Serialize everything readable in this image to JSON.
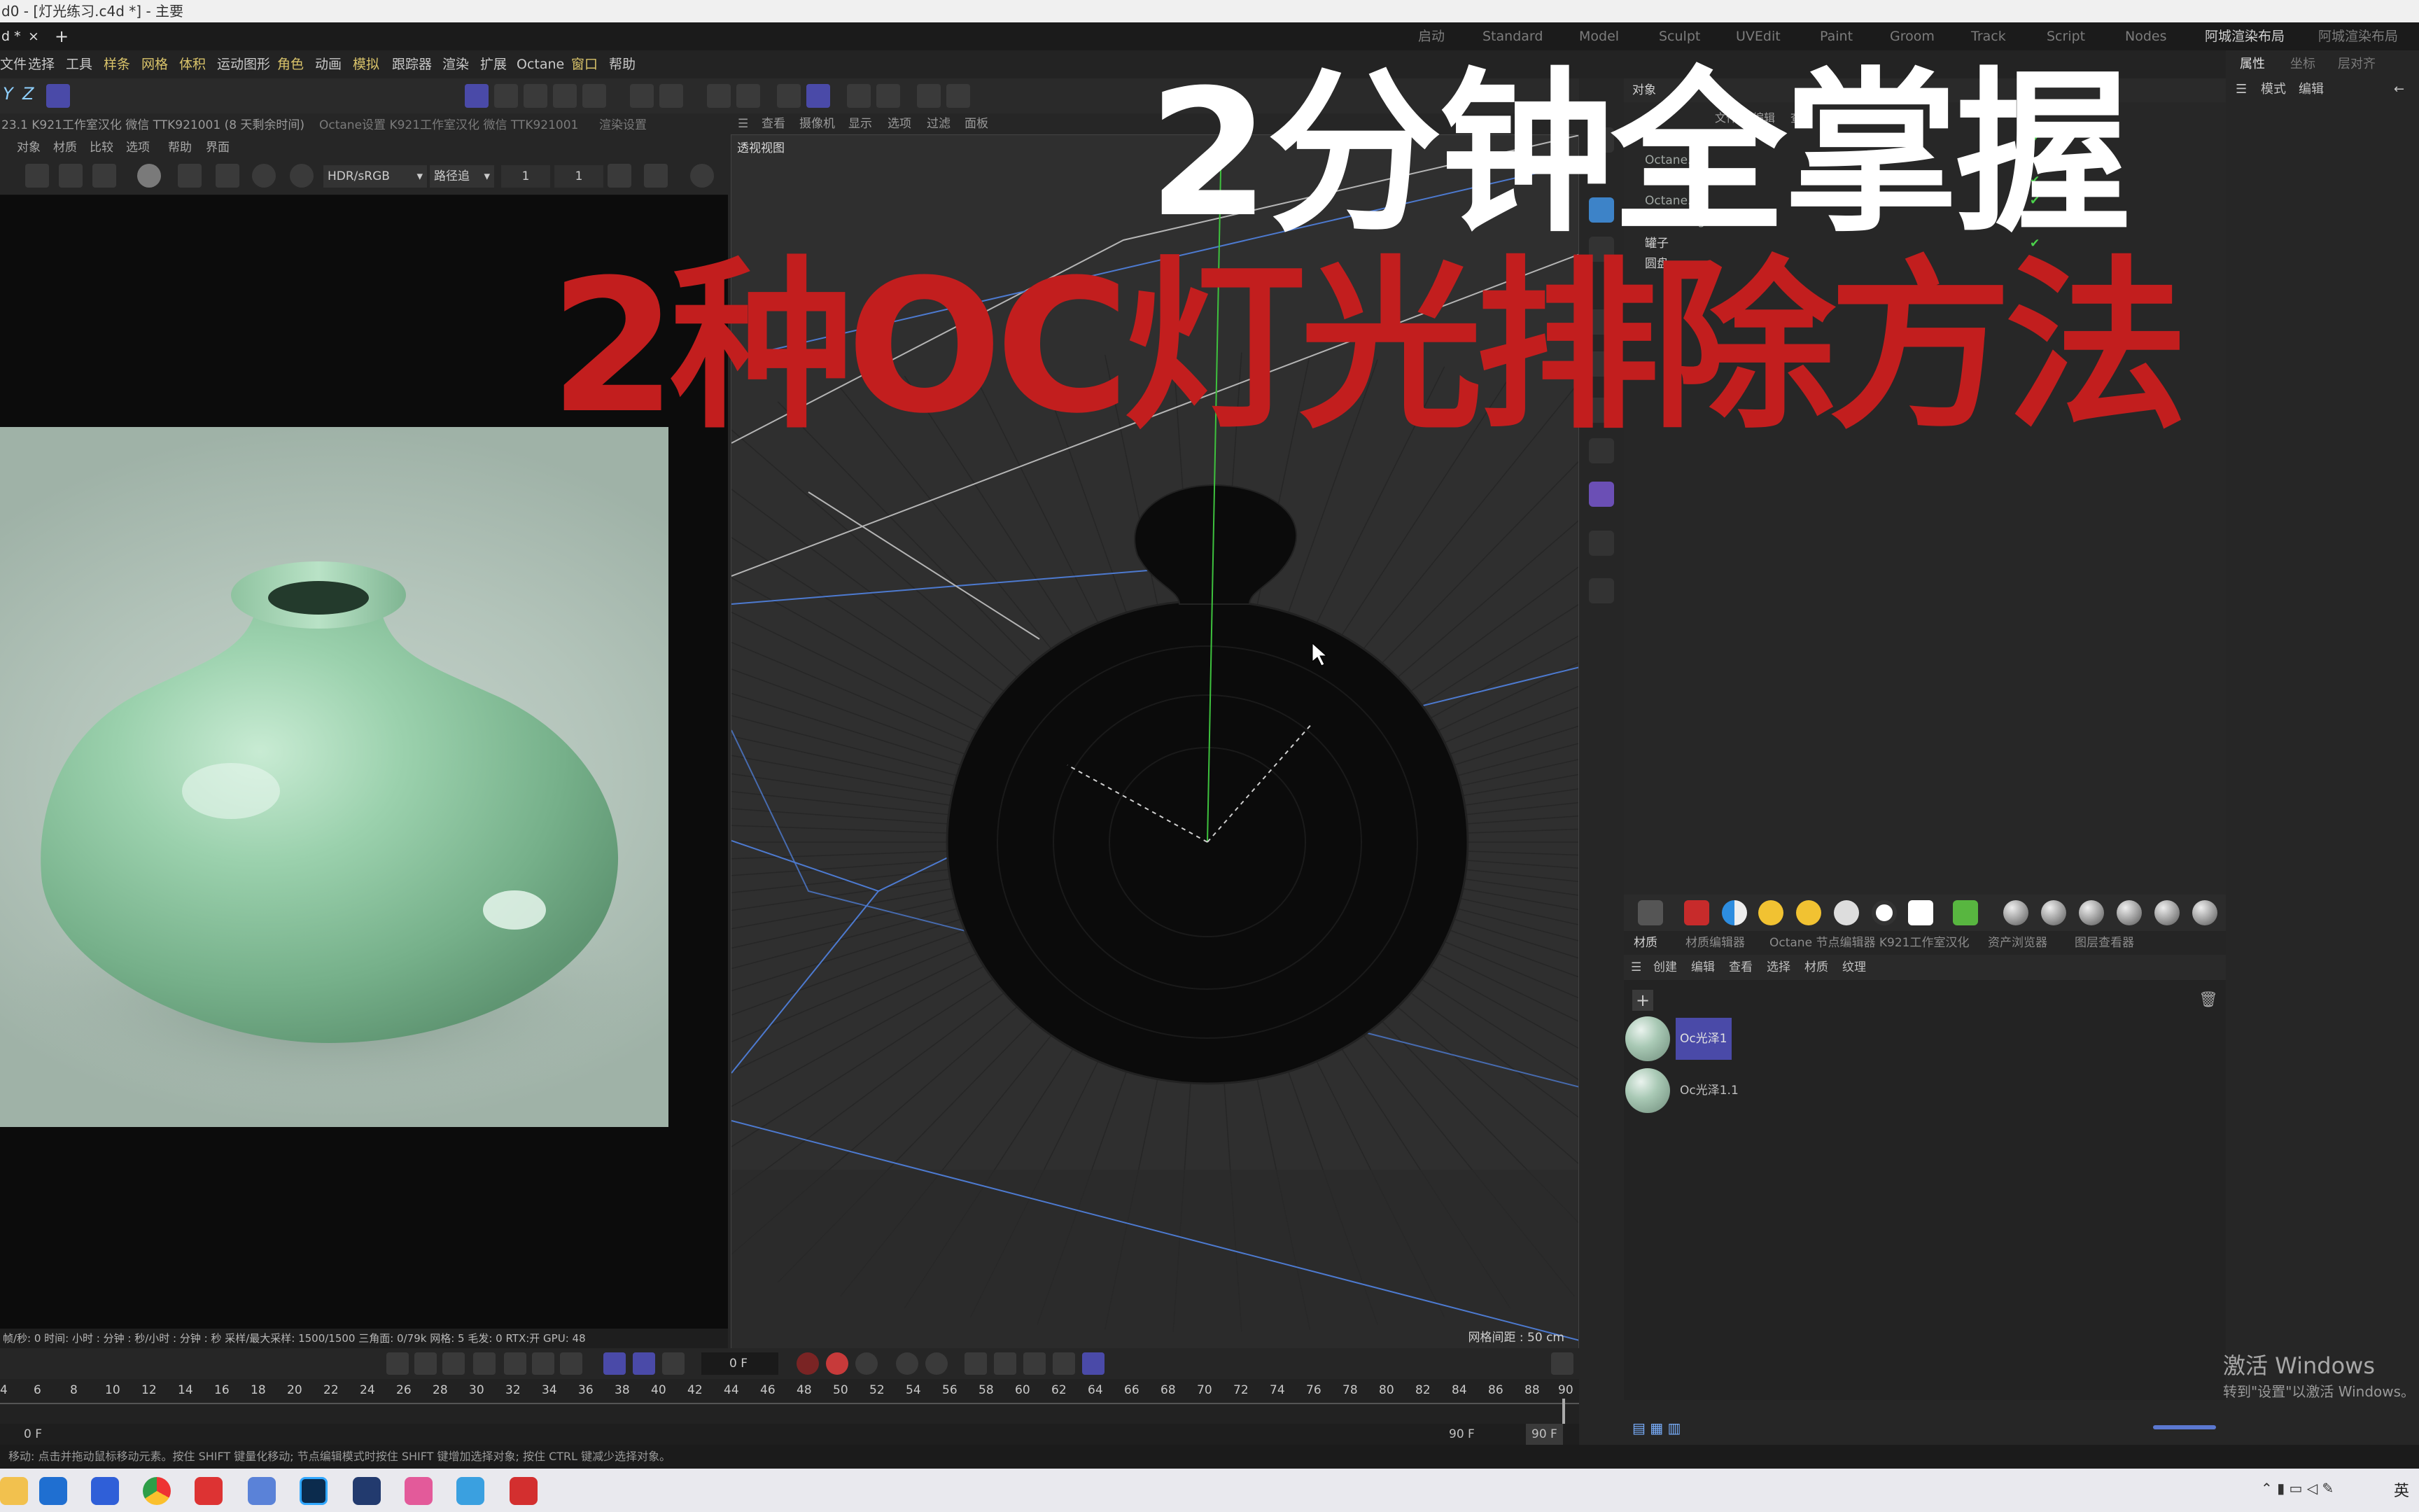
{
  "window": {
    "title": "d0 - [灯光练习.c4d *] - 主要"
  },
  "doc_tabs": {
    "active": "d *",
    "close": "×",
    "add": "+"
  },
  "layout_tabs": [
    "启动",
    "Standard",
    "Model",
    "Sculpt",
    "UVEdit",
    "Paint",
    "Groom",
    "Track",
    "Script",
    "Nodes",
    "阿城渲染布局",
    "阿城渲染布局"
  ],
  "menu": [
    "文件",
    "选择",
    "工具",
    "样条",
    "网格",
    "体积",
    "运动图形",
    "角色",
    "动画",
    "模拟",
    "跟踪器",
    "渲染",
    "扩展",
    "Octane",
    "窗口",
    "帮助"
  ],
  "axes_labels": {
    "y": "Y",
    "z": "Z"
  },
  "left_header": {
    "text": "23.1  K921工作室汉化 微信 TTK921001 (8 天剩余时间)",
    "tab2": "Octane设置  K921工作室汉化 微信 TTK921001",
    "tab3": "渲染设置"
  },
  "left_menu": [
    "对象",
    "材质",
    "比较",
    "选项",
    "帮助",
    "界面"
  ],
  "left_toolbar": {
    "color_space": "HDR/sRGB",
    "kernel": "路径追",
    "val1": "1",
    "val2": "1"
  },
  "render_status": "帧/秒: 0   时间: 小时 : 分钟 : 秒/小时 : 分钟 : 秒   采样/最大采样: 1500/1500   三角面: 0/79k  网格: 5  毛发: 0  RTX:开   GPU:   48",
  "viewport_menu": [
    "查看",
    "摄像机",
    "显示",
    "选项",
    "过滤",
    "面板"
  ],
  "viewport": {
    "label": "透视视图",
    "grid_info": "网格间距 : 50 cm"
  },
  "object_panel": {
    "title": "对象",
    "menu": [
      "文件",
      "编辑",
      "查看",
      "对象",
      "标签"
    ],
    "rows": [
      "Octane...",
      "Octane...",
      "OctaneLight",
      "Octane...",
      "OctaneLight",
      "罐子",
      "圆盘"
    ]
  },
  "attributes": {
    "tabs": [
      "属性",
      "坐标",
      "层对齐"
    ],
    "menu": [
      "模式",
      "编辑"
    ]
  },
  "material_tabs": [
    "材质",
    "材质编辑器",
    "Octane 节点编辑器  K921工作室汉化",
    "资产浏览器",
    "图层查看器"
  ],
  "material_menu": [
    "创建",
    "编辑",
    "查看",
    "选择",
    "材质",
    "纹理"
  ],
  "materials": [
    "Oc光泽1",
    "Oc光泽1.1"
  ],
  "timeline": {
    "current_frame": "0 F",
    "ticks": [
      "4",
      "6",
      "8",
      "10",
      "12",
      "14",
      "16",
      "18",
      "20",
      "22",
      "24",
      "26",
      "28",
      "30",
      "32",
      "34",
      "36",
      "38",
      "40",
      "42",
      "44",
      "46",
      "48",
      "50",
      "52",
      "54",
      "56",
      "58",
      "60",
      "62",
      "64",
      "66",
      "68",
      "70",
      "72",
      "74",
      "76",
      "78",
      "80",
      "82",
      "84",
      "86",
      "88",
      "90"
    ],
    "start": "0 F",
    "end_a": "90 F",
    "end_b": "90 F"
  },
  "statusbar": "移动: 点击并拖动鼠标移动元素。按住 SHIFT 键量化移动; 节点编辑模式时按住 SHIFT 键增加选择对象; 按住 CTRL 键减少选择对象。",
  "watermark": {
    "line1": "激活 Windows",
    "line2": "转到\"设置\"以激活 Windows。"
  },
  "overlay": {
    "line1": "2分钟全掌握",
    "line2": "2种OC灯光排除方法"
  },
  "system_tray": {
    "lang": "英"
  },
  "colors": {
    "accent_blue": "#4a4aa8",
    "title_red": "#c21e1e",
    "title_white": "#ffffff",
    "vase_green": "#8fc3a0"
  }
}
